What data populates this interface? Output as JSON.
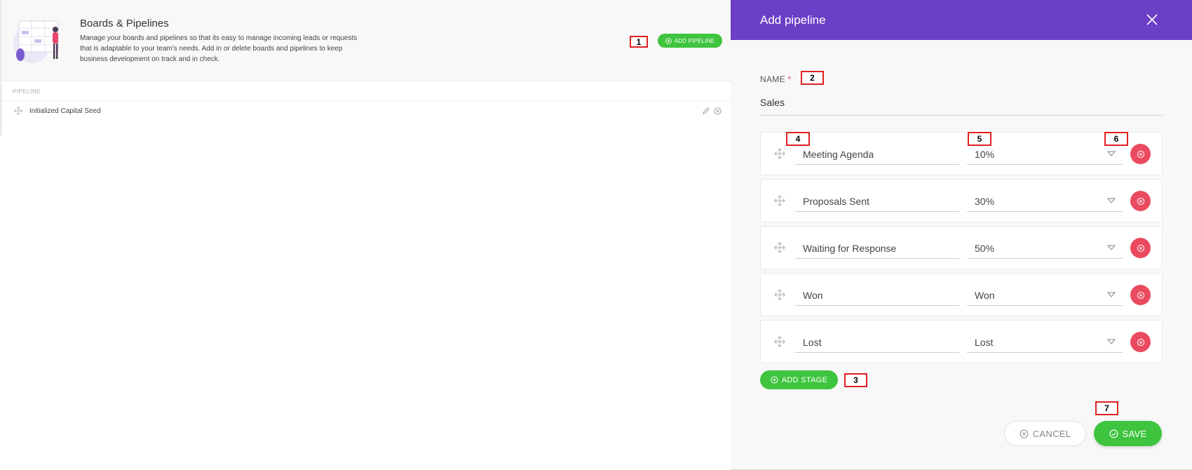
{
  "left_page": {
    "title": "Boards & Pipelines",
    "description": "Manage your boards and pipelines so that its easy to manage incoming leads or requests that is adaptable to your team's needs. Add in or delete boards and pipelines to keep business development on track and in check.",
    "add_pipeline_label": "ADD PIPELINE",
    "table_header": "PIPELINE",
    "pipelines": [
      {
        "name": "Initialized Capital Seed"
      }
    ]
  },
  "panel": {
    "title": "Add pipeline",
    "name_label": "NAME",
    "required_marker": "*",
    "name_value": "Sales",
    "stages": [
      {
        "name": "Meeting Agenda",
        "probability": "10%"
      },
      {
        "name": "Proposals Sent",
        "probability": "30%"
      },
      {
        "name": "Waiting for Response",
        "probability": "50%"
      },
      {
        "name": "Won",
        "probability": "Won"
      },
      {
        "name": "Lost",
        "probability": "Lost"
      }
    ],
    "add_stage_label": "ADD STAGE",
    "cancel_label": "CANCEL",
    "save_label": "SAVE"
  },
  "annotations": [
    "1",
    "2",
    "3",
    "4",
    "5",
    "6",
    "7"
  ],
  "colors": {
    "header_purple": "#6b3fc6",
    "green": "#3ec43e",
    "remove_red": "#ea4a5f",
    "annotation_red": "#e02020"
  },
  "icons": {
    "add": "plus-circle-icon",
    "remove": "close-circle-icon",
    "drag": "move-arrows-icon",
    "edit": "pencil-icon",
    "caret": "caret-down-icon",
    "close": "close-icon",
    "save": "check-circle-icon"
  }
}
